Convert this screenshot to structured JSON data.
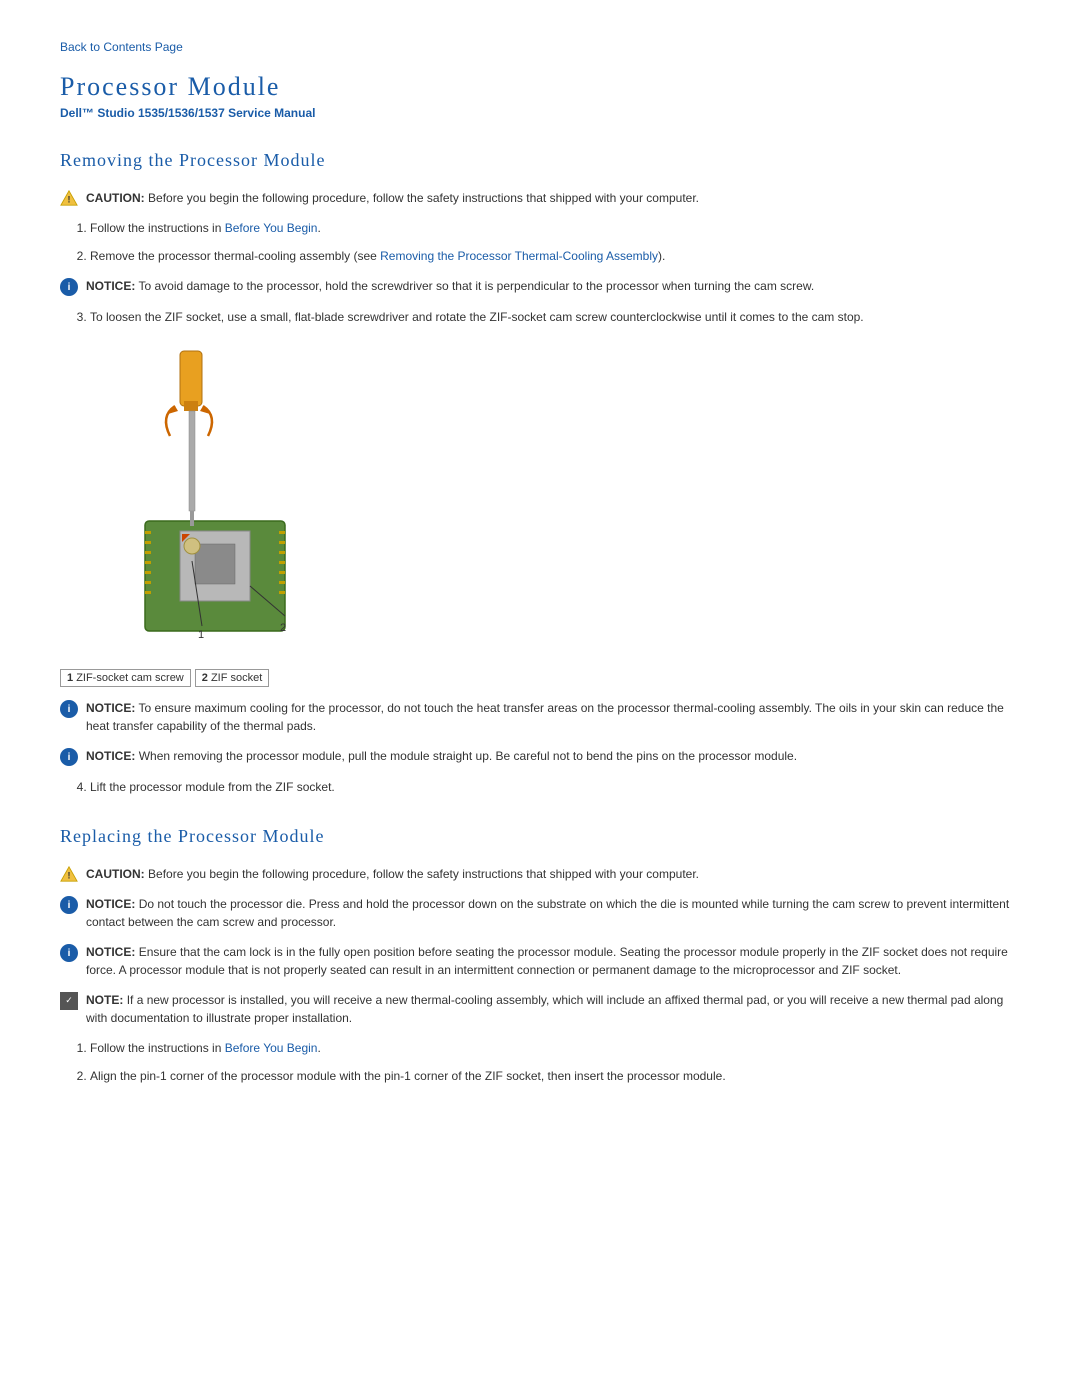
{
  "back_link": {
    "text": "Back to Contents Page",
    "href": "#"
  },
  "page": {
    "title": "Processor Module",
    "subtitle": "Dell™ Studio 1535/1536/1537 Service Manual"
  },
  "sections": {
    "removing": {
      "heading": "Removing the Processor Module",
      "caution1": {
        "label": "CAUTION:",
        "text": "Before you begin the following procedure, follow the safety instructions that shipped with your computer."
      },
      "steps": [
        {
          "text": "Follow the instructions in ",
          "link_text": "Before You Begin",
          "link_href": "#",
          "text_after": "."
        },
        {
          "text": "Remove the processor thermal-cooling assembly (see ",
          "link_text": "Removing the Processor Thermal-Cooling Assembly",
          "link_href": "#",
          "text_after": ")."
        }
      ],
      "notice1": {
        "label": "NOTICE:",
        "text": "To avoid damage to the processor, hold the screwdriver so that it is perpendicular to the processor when turning the cam screw."
      },
      "step3": "To loosen the ZIF socket, use a small, flat-blade screwdriver and rotate the ZIF-socket cam screw counterclockwise until it comes to the cam stop.",
      "image_alt": "ZIF socket screwdriver diagram",
      "caption": [
        {
          "num": "1",
          "text": "ZIF-socket cam screw"
        },
        {
          "num": "2",
          "text": "ZIF socket"
        }
      ],
      "notice2": {
        "label": "NOTICE:",
        "text": "To ensure maximum cooling for the processor, do not touch the heat transfer areas on the processor thermal-cooling assembly. The oils in your skin can reduce the heat transfer capability of the thermal pads."
      },
      "notice3": {
        "label": "NOTICE:",
        "text": "When removing the processor module, pull the module straight up. Be careful not to bend the pins on the processor module."
      },
      "step4": "Lift the processor module from the ZIF socket."
    },
    "replacing": {
      "heading": "Replacing the Processor Module",
      "caution1": {
        "label": "CAUTION:",
        "text": "Before you begin the following procedure, follow the safety instructions that shipped with your computer."
      },
      "notice1": {
        "label": "NOTICE:",
        "text": "Do not touch the processor die. Press and hold the processor down on the substrate on which the die is mounted while turning the cam screw to prevent intermittent contact between the cam screw and processor."
      },
      "notice2": {
        "label": "NOTICE:",
        "text": "Ensure that the cam lock is in the fully open position before seating the processor module. Seating the processor module properly in the ZIF socket does not require force. A processor module that is not properly seated can result in an intermittent connection or permanent damage to the microprocessor and ZIF socket."
      },
      "note1": {
        "label": "NOTE:",
        "text": "If a new processor is installed, you will receive a new thermal-cooling assembly, which will include an affixed thermal pad, or you will receive a new thermal pad along with documentation to illustrate proper installation."
      },
      "steps": [
        {
          "text": "Follow the instructions in ",
          "link_text": "Before You Begin",
          "link_href": "#",
          "text_after": "."
        },
        {
          "text": "Align the pin-1 corner of the processor module with the pin-1 corner of the ZIF socket, then insert the processor module.",
          "link_text": null
        }
      ]
    }
  }
}
